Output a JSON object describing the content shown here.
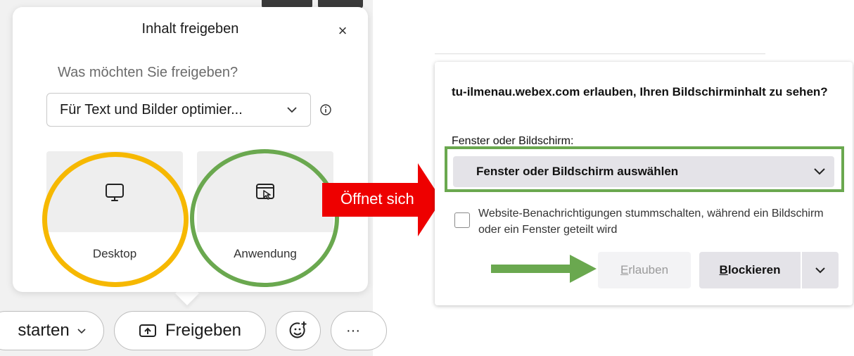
{
  "share_popover": {
    "title": "Inhalt freigeben",
    "close": "×",
    "question": "Was möchten Sie freigeben?",
    "optimize_select": {
      "value": "Für Text und Bilder optimier...",
      "icon": "chevron-down-icon"
    },
    "info_icon": "info-icon",
    "options": [
      {
        "label": "Desktop",
        "icon": "monitor-icon",
        "highlight": "#f6b800"
      },
      {
        "label": "Anwendung",
        "icon": "app-window-cursor-icon",
        "highlight": "#6aa84f"
      }
    ]
  },
  "control_bar": {
    "start_label": "starten",
    "share_label": "Freigeben",
    "reactions_icon": "smiley-plus-icon",
    "more_label": "···"
  },
  "annotation": {
    "arrow_text": "Öffnet sich",
    "arrow_color": "#ee0000",
    "highlight_color": "#6aa84f"
  },
  "browser_dialog": {
    "title": "tu-ilmenau.webex.com erlauben, Ihren Bildschirminhalt zu sehen?",
    "window_label": "Fenster oder Bildschirm:",
    "window_select": "Fenster oder Bildschirm auswählen",
    "mute_checkbox_label": "Website-Benachrichtigungen stummschalten, während ein Bildschirm oder ein Fenster geteilt wird",
    "allow_first": "E",
    "allow_rest": "rlauben",
    "block_first": "B",
    "block_rest": "lockieren"
  }
}
